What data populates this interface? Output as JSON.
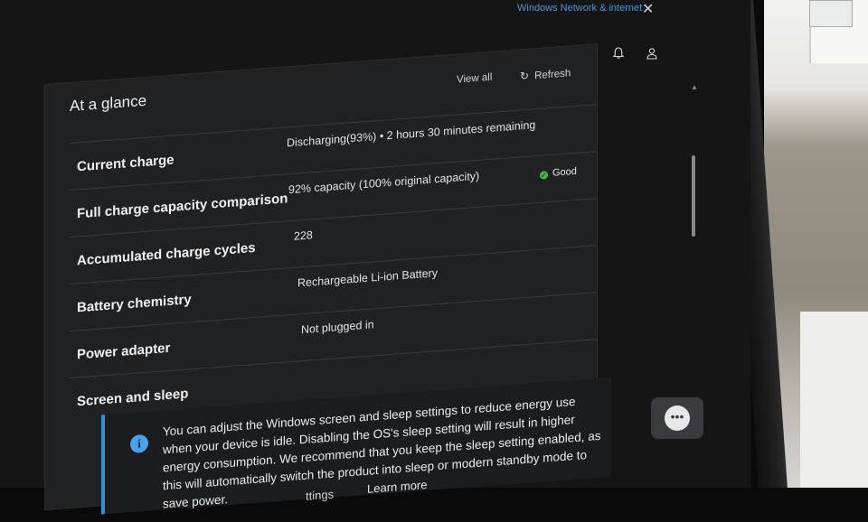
{
  "topbar": {
    "network_link": "Windows Network & internet",
    "close_symbol": "✕"
  },
  "header_icons": [
    "bell-icon",
    "person-icon"
  ],
  "panel": {
    "title": "At a glance",
    "view_all": "View all",
    "refresh": "Refresh",
    "rows": [
      {
        "label": "Current charge",
        "value": "Discharging(93%)  •  2 hours 30 minutes remaining"
      },
      {
        "label": "Full charge capacity comparison",
        "value": "92% capacity (100% original capacity)",
        "badge": "Good",
        "badge_color": "#3fb950"
      },
      {
        "label": "Accumulated charge cycles",
        "value": "228"
      },
      {
        "label": "Battery chemistry",
        "value": "Rechargeable Li-ion Battery"
      },
      {
        "label": "Power adapter",
        "value": "Not plugged in"
      },
      {
        "label": "Screen and sleep",
        "value": ""
      }
    ],
    "info": {
      "text": "You can adjust the Windows screen and sleep settings to reduce energy use when your device is idle. Disabling the OS's sleep setting will result in higher energy consumption. We recommend that you keep the sleep setting enabled, as this will automatically switch the product into sleep or modern standby mode to save power.",
      "settings_fragment": "ttings",
      "learn_more": "Learn more",
      "accent_color": "#2f8fd8"
    }
  }
}
